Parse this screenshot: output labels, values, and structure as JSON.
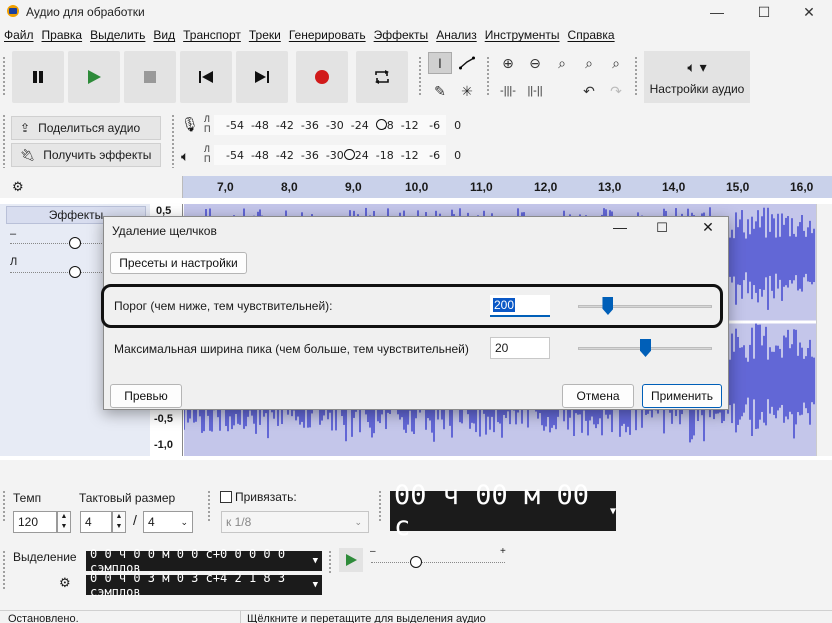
{
  "window": {
    "title": "Аудио для обработки",
    "min": "—",
    "max": "☐",
    "close": "✕"
  },
  "menu": [
    "Файл",
    "Правка",
    "Выделить",
    "Вид",
    "Транспорт",
    "Треки",
    "Генерировать",
    "Эффекты",
    "Анализ",
    "Инструменты",
    "Справка"
  ],
  "toolbar": {
    "audio_settings_label": "Настройки аудио"
  },
  "share": {
    "share_label": "Поделиться аудио",
    "get_effects_label": "Получить эффекты"
  },
  "meters": {
    "rec_lr": "Л\nП",
    "play_lr": "Л\nП",
    "rec_scale": "-54  -48  -42  -36  -30  -24  -18  -12   -6    0",
    "play_scale": "-54  -48  -42  -36  -30  -24  -18  -12   -6    0"
  },
  "ruler": [
    "7,0",
    "8,0",
    "9,0",
    "10,0",
    "11,0",
    "12,0",
    "13,0",
    "14,0",
    "15,0",
    "16,0"
  ],
  "track": {
    "effects_label": "Эффекты",
    "gain_minus": "–",
    "pan_l": "Л",
    "amp_labels": [
      "0,5",
      "-0,5",
      "-1,0"
    ]
  },
  "bottom": {
    "tempo_label": "Темп",
    "tempo_value": "120",
    "timesig_label": "Тактовый размер",
    "timesig_num": "4",
    "timesig_sep": "/",
    "timesig_den": "4",
    "snap_label": "Привязать:",
    "snap_value": "к 1/8",
    "time_display": "00 ч 00 м 00 с",
    "selection_label": "Выделение",
    "sel_start": "0 0 ч 0 0 м 0 0 с+0 0 0 0 0  сэмплов",
    "sel_end": "0 0 ч 0 3 м 0 3 с+4 2 1 8 3  сэмплов",
    "speed_minus": "–",
    "speed_plus": "+"
  },
  "status": {
    "left": "Остановлено.",
    "right": "Щёлкните и перетащите для выделения аудио"
  },
  "dialog": {
    "title": "Удаление щелчков",
    "presets_button": "Пресеты и настройки",
    "threshold_label": "Порог (чем ниже, тем чувствительней):",
    "threshold_value": "200",
    "threshold_level": 0.22,
    "width_label": "Максимальная ширина пика (чем больше, тем чувствительней)",
    "width_value": "20",
    "width_level": 0.5,
    "preview_button": "Превью",
    "cancel_button": "Отмена",
    "apply_button": "Применить"
  },
  "colors": {
    "accent": "#005fb8",
    "waveform": "#4a4fd0",
    "highlight": "#111111"
  }
}
